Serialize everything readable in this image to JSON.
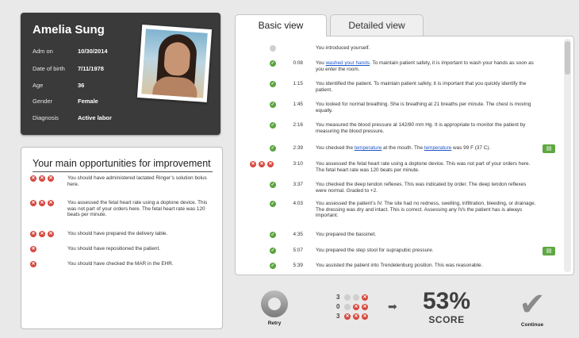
{
  "patient": {
    "name": "Amelia Sung",
    "fields": [
      {
        "label": "Adm on",
        "value": "10/30/2014"
      },
      {
        "label": "Date of birth",
        "value": "7/11/1978"
      },
      {
        "label": "Age",
        "value": "36"
      },
      {
        "label": "Gender",
        "value": "Female"
      },
      {
        "label": "Diagnosis",
        "value": "Active labor"
      }
    ]
  },
  "opportunities": {
    "title": "Your main opportunities for improvement",
    "items": [
      {
        "misses": 3,
        "text": "You should have administered lactated Ringer’s solution bolus here."
      },
      {
        "misses": 3,
        "text": "You assessed the fetal heart rate using a doptone device. This was not part of your orders here. The fetal heart rate was 120 beats per minute."
      },
      {
        "misses": 3,
        "text": "You should have prepared the delivery table."
      },
      {
        "misses": 1,
        "text": "You should have repositioned the patient."
      },
      {
        "misses": 1,
        "text": "You should have checked the MAR in the EHR."
      }
    ]
  },
  "tabs": {
    "basic": "Basic view",
    "detailed": "Detailed view"
  },
  "log": [
    {
      "status": "neutral",
      "time": "",
      "text": "You introduced yourself."
    },
    {
      "status": "ok",
      "time": "0:08",
      "pre": "You ",
      "link": "washed your hands",
      "post": ". To maintain patient safety, it is important to wash your hands as soon as you enter the room."
    },
    {
      "status": "ok",
      "time": "1:15",
      "text": "You identified the patient. To maintain patient safety, it is important that you quickly identify the patient."
    },
    {
      "status": "ok",
      "time": "1:45",
      "text": "You looked for normal breathing. She is breathing at 21 breaths per minute. The chest is moving equally."
    },
    {
      "status": "ok",
      "time": "2:16",
      "text": "You measured the blood pressure at 142/80 mm Hg. It is appropriate to monitor the patient by measuring the blood pressure."
    },
    {
      "status": "ok",
      "time": "2:39",
      "pre": "You checked the ",
      "link": "temperature",
      "mid": " at the mouth. The ",
      "link2": "temperature",
      "post": " was 99 F (37 C).",
      "note": true
    },
    {
      "status": "x3",
      "time": "3:10",
      "text": "You assessed the fetal heart rate using a doptone device. This was not part of your orders here. The fetal heart rate was 120 beats per minute."
    },
    {
      "status": "ok",
      "time": "3:37",
      "text": "You checked the deep tendon reflexes. This was indicated by order. The deep tendon reflexes were normal. Graded to +2."
    },
    {
      "status": "ok",
      "time": "4:03",
      "text": "You assessed the patient’s IV. The site had no redness, swelling, infiltration, bleeding, or drainage. The dressing was dry and intact. This is correct. Assessing any IVs the patient has is always important."
    },
    {
      "status": "ok",
      "time": "4:35",
      "text": "You prepared the bassinet."
    },
    {
      "status": "ok",
      "time": "5:07",
      "text": "You prepared the step stool for suprapubic pressure.",
      "note": true
    },
    {
      "status": "ok",
      "time": "5:39",
      "text": "You assisted the patient into Trendelenburg position. This was reasonable."
    }
  ],
  "bottom": {
    "retry_label": "Retry",
    "tally": [
      {
        "count": "3",
        "reds": 1
      },
      {
        "count": "0",
        "reds": 2
      },
      {
        "count": "3",
        "reds": 3
      }
    ],
    "score_value": "53%",
    "score_label": "SCORE",
    "continue_label": "Continue"
  },
  "colors": {
    "ok": "#5aa43e",
    "error": "#d6483f",
    "link": "#1f55c7"
  }
}
